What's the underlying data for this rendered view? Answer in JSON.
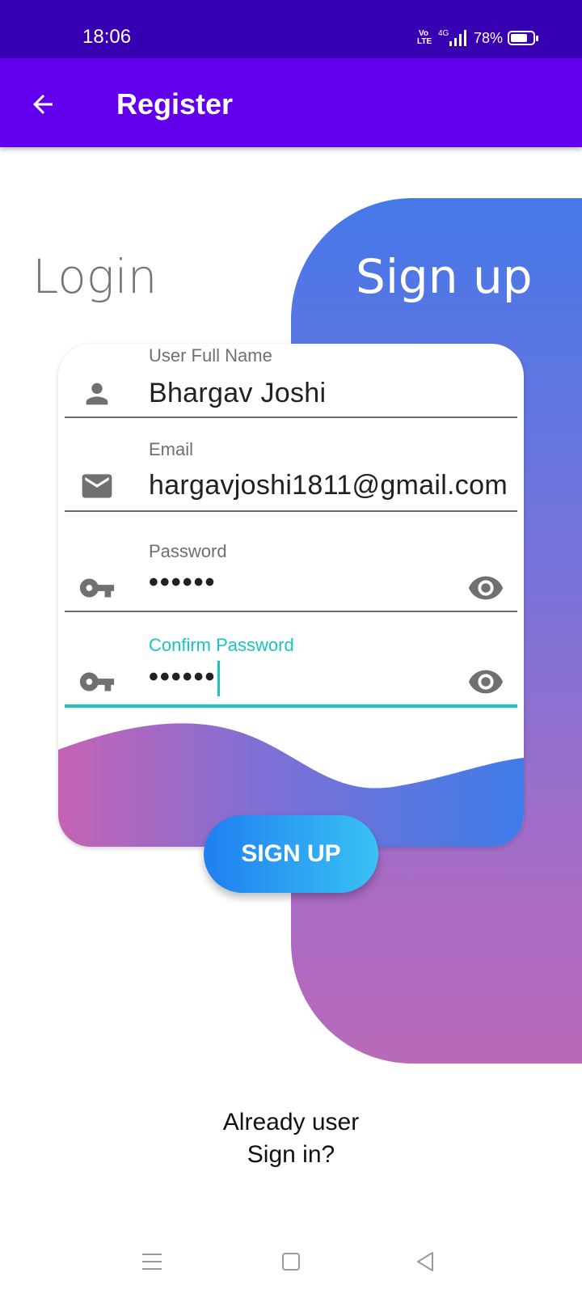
{
  "status_bar": {
    "time": "18:06",
    "volte": "Vo LTE",
    "network": "4G",
    "battery_percent_text": "78%",
    "battery_level": 0.78
  },
  "app_bar": {
    "title": "Register",
    "back_icon": "arrow-back-icon"
  },
  "tabs": {
    "login": "Login",
    "signup": "Sign up"
  },
  "form": {
    "full_name": {
      "label": "User Full Name",
      "value": "Bhargav Joshi",
      "icon": "person-icon"
    },
    "email": {
      "label": "Email",
      "value": "hargavjoshi1811@gmail.com",
      "icon": "mail-icon"
    },
    "password": {
      "label": "Password",
      "value": "••••••",
      "icon": "key-icon"
    },
    "confirm_password": {
      "label": "Confirm Password",
      "value": "••••••",
      "icon": "key-icon"
    }
  },
  "signup_button": "SIGN UP",
  "footer": {
    "line1": "Already user",
    "line2": "Sign in?"
  },
  "colors": {
    "status_bar": "#3700b3",
    "app_bar": "#6200ee",
    "accent": "#18c5c2",
    "button_start": "#1f7ff0",
    "button_end": "#3ac2f5"
  }
}
